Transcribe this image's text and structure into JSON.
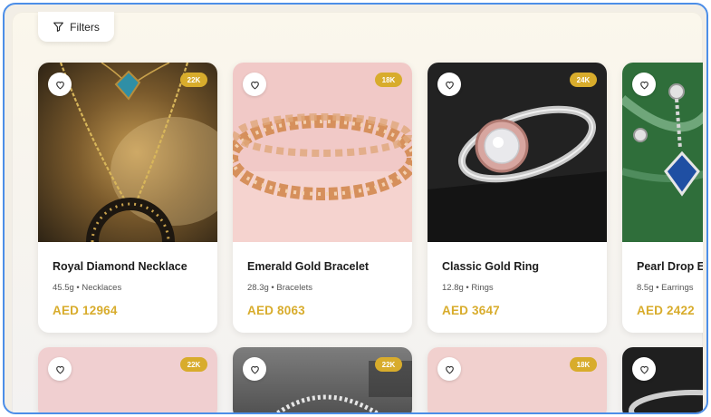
{
  "filters": {
    "label": "Filters",
    "icon": "filter-icon"
  },
  "colors": {
    "accent_gold": "#d8ac2c",
    "frame_border": "#4c8ee8"
  },
  "products": [
    {
      "name": "Royal Diamond Necklace",
      "weight": "45.5g",
      "category": "Necklaces",
      "price": "AED 12964",
      "karat": "22K"
    },
    {
      "name": "Emerald Gold Bracelet",
      "weight": "28.3g",
      "category": "Bracelets",
      "price": "AED 8063",
      "karat": "18K"
    },
    {
      "name": "Classic Gold Ring",
      "weight": "12.8g",
      "category": "Rings",
      "price": "AED 3647",
      "karat": "24K"
    },
    {
      "name": "Pearl Drop Earrings",
      "weight": "8.5g",
      "category": "Earrings",
      "price": "AED 2422",
      "karat": ""
    }
  ],
  "row2_badges": [
    "22K",
    "22K",
    "18K",
    ""
  ],
  "meta_separator": "•"
}
